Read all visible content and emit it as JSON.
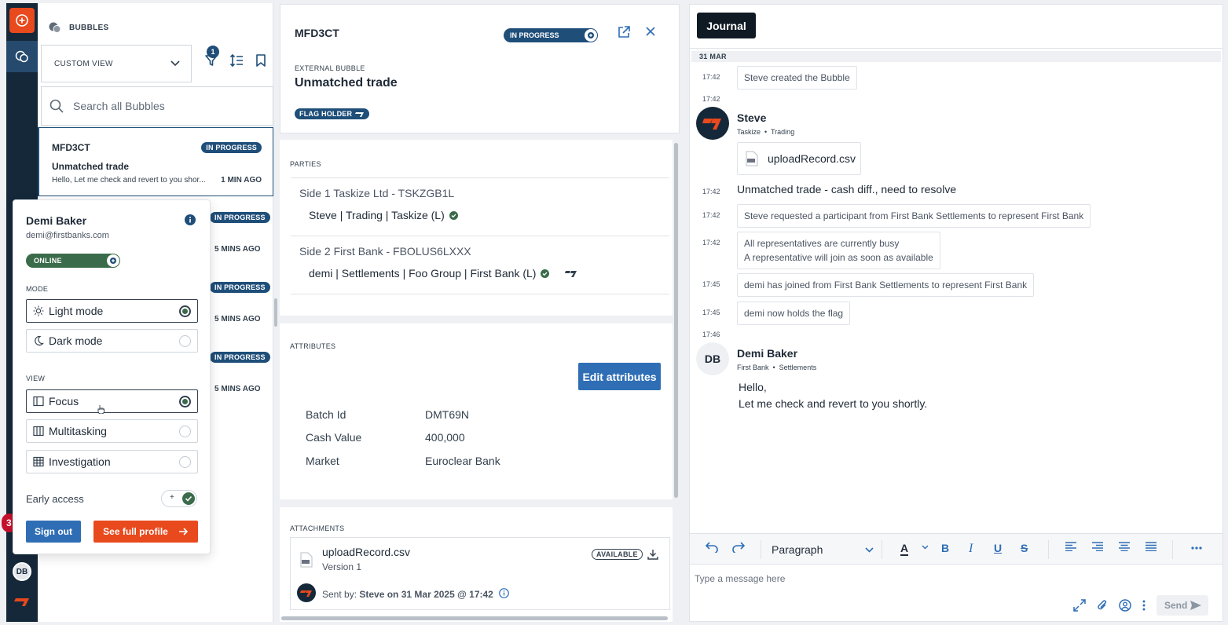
{
  "rail": {
    "badge_count": "3",
    "avatar_initials": "DB"
  },
  "list": {
    "header": "BUBBLES",
    "view_select": "CUSTOM VIEW",
    "filter_count": "1",
    "search_placeholder": "Search all Bubbles",
    "active_card": {
      "ref": "MFD3CT",
      "status": "IN PROGRESS",
      "title": "Unmatched trade",
      "message": "Hello, Let me check and revert to you shor...",
      "time": "1 MIN AGO"
    },
    "ghost_cards": [
      {
        "status": "IN PROGRESS",
        "time": "5 MINS AGO"
      },
      {
        "status": "IN PROGRESS",
        "time": "5 MINS AGO"
      },
      {
        "status": "IN PROGRESS",
        "time": "5 MINS AGO"
      }
    ]
  },
  "profile": {
    "name": "Demi Baker",
    "email": "demi@firstbanks.com",
    "status": "ONLINE",
    "mode_label": "MODE",
    "modes": [
      {
        "label": "Light mode",
        "selected": true
      },
      {
        "label": "Dark mode",
        "selected": false
      }
    ],
    "view_label": "VIEW",
    "views": [
      {
        "label": "Focus",
        "selected": true
      },
      {
        "label": "Multitasking",
        "selected": false
      },
      {
        "label": "Investigation",
        "selected": false
      }
    ],
    "early_access": "Early access",
    "early_access_toggle_symbol": "+",
    "sign_out": "Sign out",
    "see_profile": "See full profile"
  },
  "details": {
    "ref": "MFD3CT",
    "status": "IN PROGRESS",
    "kind": "EXTERNAL BUBBLE",
    "title": "Unmatched trade",
    "flag": "FLAG HOLDER",
    "parties_title": "PARTIES",
    "side1": "Side 1 Taskize Ltd - TSKZGB1L",
    "side1_member": "Steve | Trading | Taskize (L)",
    "side2": "Side 2 First Bank - FBOLUS6LXXX",
    "side2_member": "demi | Settlements | Foo Group | First Bank (L)",
    "attributes_title": "ATTRIBUTES",
    "edit_attributes": "Edit attributes",
    "attributes": [
      {
        "key": "Batch Id",
        "value": "DMT69N"
      },
      {
        "key": "Cash Value",
        "value": "400,000"
      },
      {
        "key": "Market",
        "value": "Euroclear Bank"
      }
    ],
    "attachments_title": "ATTACHMENTS",
    "attachment": {
      "name": "uploadRecord.csv",
      "version": "Version 1",
      "availability": "AVAILABLE",
      "sent_prefix": "Sent by: ",
      "sent_by": "Steve on 31 Mar 2025 @ 17:42"
    }
  },
  "journal": {
    "tab": "Journal",
    "date": "31 MAR",
    "entries": {
      "t1": "17:42",
      "s1": "Steve created the Bubble",
      "t2": "17:42",
      "author1": "Steve",
      "org1": "Taskize",
      "dept1": "Trading",
      "file": "uploadRecord.csv",
      "t3": "17:42",
      "msg1": "Unmatched trade - cash diff., need to resolve",
      "t4": "17:42",
      "s2": "Steve requested a participant from First Bank Settlements to represent First Bank",
      "t5": "17:42",
      "s3a": "All representatives are currently busy",
      "s3b": "A representative will join as soon as available",
      "t6": "17:45",
      "s4": "demi has joined from First Bank Settlements to represent First Bank",
      "t7": "17:45",
      "s5": "demi now holds the flag",
      "t8": "17:46",
      "author2": "Demi Baker",
      "initials2": "DB",
      "org2": "First Bank",
      "dept2": "Settlements",
      "msg2a": "Hello,",
      "msg2b": "Let me check and revert to you shortly."
    },
    "toolbar": {
      "paragraph": "Paragraph",
      "text_color": "A",
      "bold": "B",
      "italic": "I",
      "underline": "U",
      "strike": "S"
    },
    "input_placeholder": "Type a message here",
    "send": "Send"
  },
  "colors": {
    "navy": "#15283a",
    "accent_orange": "#e8491d",
    "primary_blue": "#2f6eb5",
    "status_blue": "#1f4e79",
    "online_green": "#3a6b4a"
  }
}
